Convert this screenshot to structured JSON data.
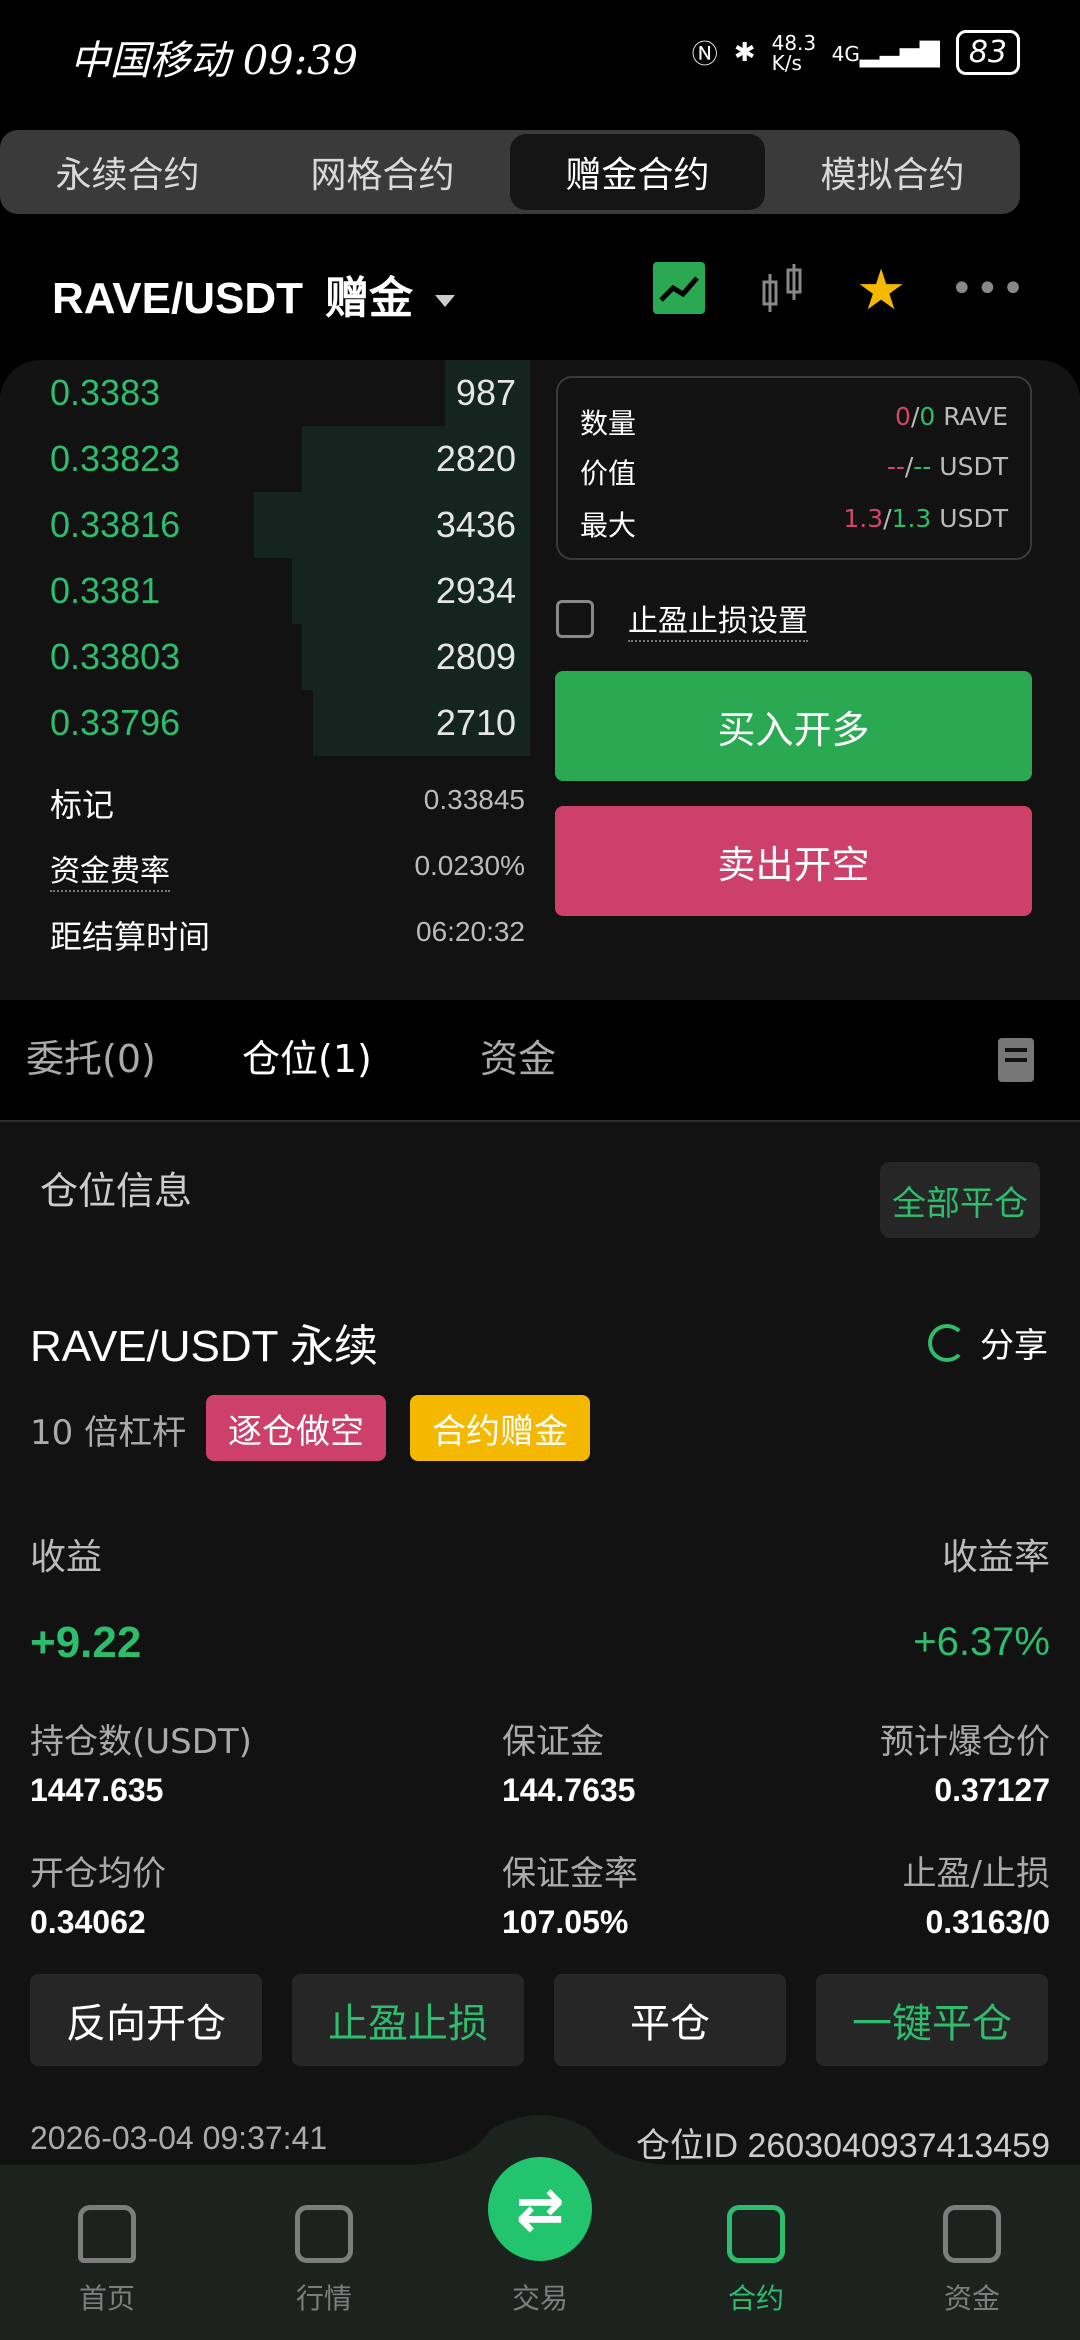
{
  "status": {
    "carrier": "中国移动",
    "time": "09:39",
    "net": "48.3 K/s",
    "signal": "4G",
    "battery": "83"
  },
  "tabs": [
    {
      "label": "永续合约"
    },
    {
      "label": "网格合约"
    },
    {
      "label": "赠金合约"
    },
    {
      "label": "模拟合约"
    }
  ],
  "pair": {
    "symbol": "RAVE/USDT",
    "mode": "赠金"
  },
  "orderbook": [
    {
      "price": "0.3383",
      "qty": "987",
      "depth": 0.16
    },
    {
      "price": "0.33823",
      "qty": "2820",
      "depth": 0.43
    },
    {
      "price": "0.33816",
      "qty": "3436",
      "depth": 0.52
    },
    {
      "price": "0.3381",
      "qty": "2934",
      "depth": 0.45
    },
    {
      "price": "0.33803",
      "qty": "2809",
      "depth": 0.43
    },
    {
      "price": "0.33796",
      "qty": "2710",
      "depth": 0.41
    }
  ],
  "info": {
    "mark_label": "标记",
    "mark_value": "0.33845",
    "funding_label": "资金费率",
    "funding_value": "0.0230%",
    "settle_label": "距结算时间",
    "settle_value": "06:20:32"
  },
  "summary": {
    "qty_label": "数量",
    "qty_a": "0",
    "qty_sep": "/",
    "qty_b": "0",
    "qty_unit": "RAVE",
    "value_label": "价值",
    "value_a": "--",
    "value_sep": "/",
    "value_b": "--",
    "value_unit": "USDT",
    "max_label": "最大",
    "max_a": "1.3",
    "max_sep": "/",
    "max_b": "1.3",
    "max_unit": "USDT"
  },
  "tpsl_setting": "止盈止损设置",
  "buttons": {
    "buy": "买入开多",
    "sell": "卖出开空"
  },
  "order_tabs": [
    {
      "label": "委托(0)"
    },
    {
      "label": "仓位(1)"
    },
    {
      "label": "资金"
    }
  ],
  "position": {
    "section_title": "仓位信息",
    "close_all": "全部平仓",
    "name": "RAVE/USDT",
    "type": "永续",
    "share": "分享",
    "leverage": "10 倍杠杆",
    "badge_short": "逐仓做空",
    "badge_bonus": "合约赠金",
    "pnl_label": "收益",
    "pnl_value": "+9.22",
    "roe_label": "收益率",
    "roe_value": "+6.37%",
    "stats": [
      {
        "label": "持仓数(USDT)",
        "value": "1447.635"
      },
      {
        "label": "保证金",
        "value": "144.7635"
      },
      {
        "label": "预计爆仓价",
        "value": "0.37127"
      },
      {
        "label": "开仓均价",
        "value": "0.34062"
      },
      {
        "label": "保证金率",
        "value": "107.05%"
      },
      {
        "label": "止盈/止损",
        "value": "0.3163/0"
      }
    ],
    "actions": [
      "反向开仓",
      "止盈止损",
      "平仓",
      "一键平仓"
    ],
    "time": "2026-03-04 09:37:41",
    "position_id": "仓位ID 2603040937413459"
  },
  "nav": [
    {
      "label": "首页"
    },
    {
      "label": "行情"
    },
    {
      "label": "交易"
    },
    {
      "label": "合约"
    },
    {
      "label": "资金"
    }
  ],
  "colors": {
    "green": "#2ebd6d",
    "red": "#cd406a",
    "yellow": "#f5b800",
    "bg": "#121212"
  }
}
